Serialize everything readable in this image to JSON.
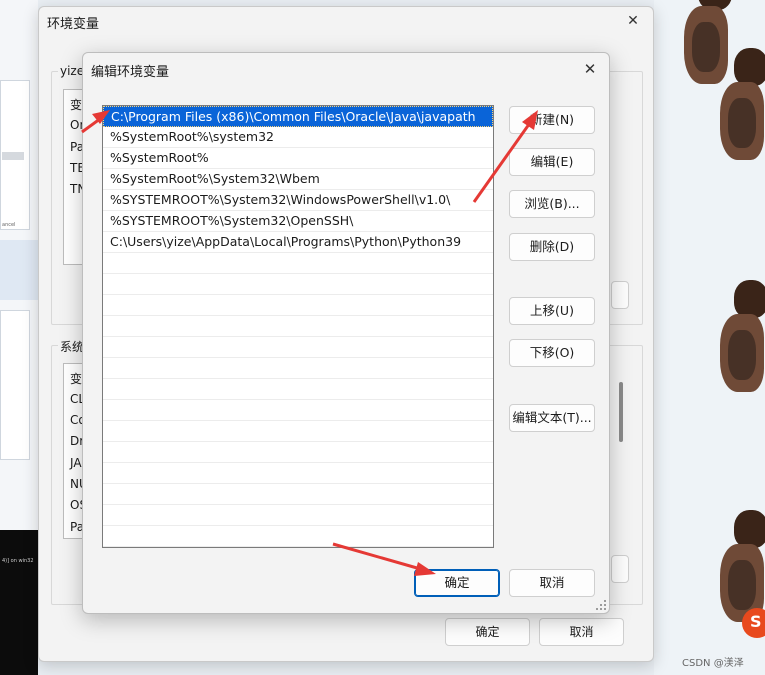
{
  "back_window": {
    "title": "环境变量",
    "user_group_legend": "yize",
    "user_vars": [
      "变",
      "On",
      "Pa",
      "TE",
      "TN"
    ],
    "system_group_legend": "系统",
    "system_vars": [
      "变",
      "CL",
      "Co",
      "Dr",
      "JA",
      "NU",
      "OS",
      "Pa"
    ],
    "ok_label": "确定",
    "cancel_label": "取消"
  },
  "dialog": {
    "title": "编辑环境变量",
    "paths": [
      "C:\\Program Files (x86)\\Common Files\\Oracle\\Java\\javapath",
      "%SystemRoot%\\system32",
      "%SystemRoot%",
      "%SystemRoot%\\System32\\Wbem",
      "%SYSTEMROOT%\\System32\\WindowsPowerShell\\v1.0\\",
      "%SYSTEMROOT%\\System32\\OpenSSH\\",
      "C:\\Users\\yize\\AppData\\Local\\Programs\\Python\\Python39"
    ],
    "selected_index": 0,
    "buttons": {
      "new": "新建(N)",
      "edit": "编辑(E)",
      "browse": "浏览(B)...",
      "delete": "删除(D)",
      "move_up": "上移(U)",
      "move_down": "下移(O)",
      "edit_text": "编辑文本(T)...",
      "ok": "确定",
      "cancel": "取消"
    }
  },
  "background": {
    "terminal_text": "4)] on win32",
    "left_pane_text": "ancel",
    "watermark": "CSDN @渼泽"
  },
  "colors": {
    "selection": "#0a64d8",
    "arrow": "#e53935",
    "primary_border": "#005fb8"
  }
}
